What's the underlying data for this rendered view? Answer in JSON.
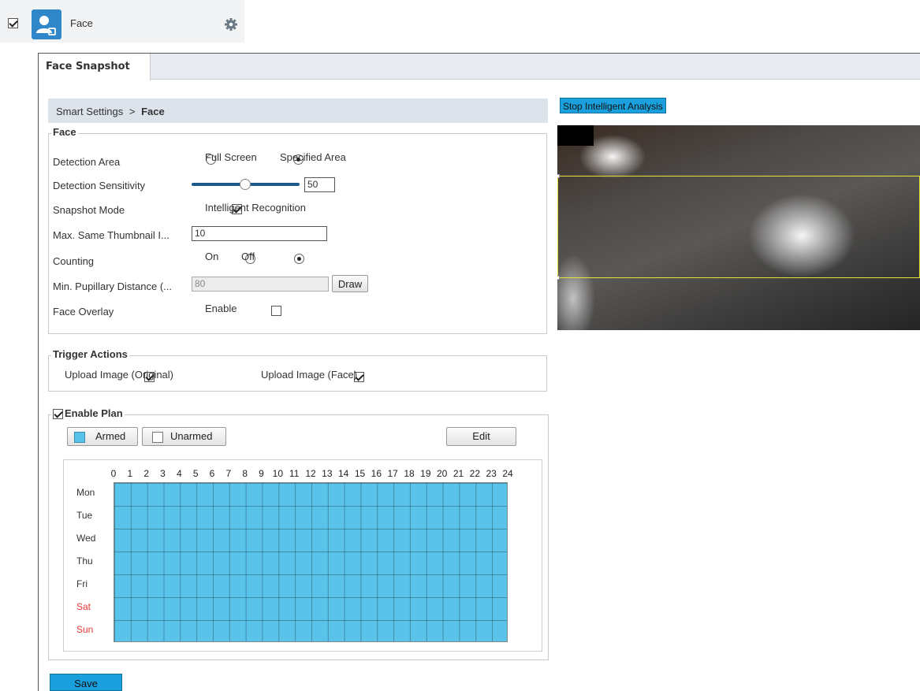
{
  "top_item": {
    "label": "Face",
    "checked": true
  },
  "tab": {
    "title": "Face Snapshot"
  },
  "breadcrumb": {
    "parent": "Smart Settings",
    "separator": ">",
    "current": "Face"
  },
  "face_group": {
    "legend": "Face",
    "detection_area": {
      "label": "Detection Area",
      "options": [
        "Full Screen",
        "Specified Area"
      ],
      "selected": "Specified Area"
    },
    "sensitivity": {
      "label": "Detection Sensitivity",
      "value": "50",
      "level": 0.5
    },
    "snapshot_mode": {
      "label": "Snapshot Mode",
      "option": "Intelligent Recognition",
      "checked": true
    },
    "max_thumbnail": {
      "label": "Max. Same Thumbnail I...",
      "value": "10"
    },
    "counting": {
      "label": "Counting",
      "options": [
        "On",
        "Off"
      ],
      "selected": "Off"
    },
    "pupillary": {
      "label": "Min. Pupillary Distance (...",
      "value": "80",
      "draw_label": "Draw"
    },
    "overlay": {
      "label": "Face Overlay",
      "option": "Enable",
      "checked": false
    }
  },
  "trigger_actions": {
    "legend": "Trigger Actions",
    "upload_original": "Upload Image  (Original)",
    "upload_face": "Upload Image  (Face)"
  },
  "plan": {
    "legend": "Enable Plan",
    "armed_label": "Armed",
    "unarmed_label": "Unarmed",
    "edit_label": "Edit",
    "hours": [
      "0",
      "1",
      "2",
      "3",
      "4",
      "5",
      "6",
      "7",
      "8",
      "9",
      "10",
      "11",
      "12",
      "13",
      "14",
      "15",
      "16",
      "17",
      "18",
      "19",
      "20",
      "21",
      "22",
      "23",
      "24"
    ],
    "days": [
      "Mon",
      "Tue",
      "Wed",
      "Thu",
      "Fri",
      "Sat",
      "Sun"
    ],
    "armed_color": "#59c3ea",
    "weekend_color": "#e53935"
  },
  "video": {
    "stop_label": "Stop Intelligent Analysis"
  },
  "save_label": "Save"
}
